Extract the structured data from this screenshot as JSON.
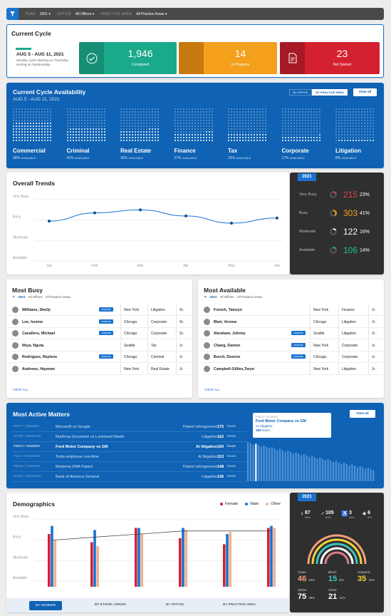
{
  "filter": {
    "year_label": "YEAR",
    "year": "2021",
    "office_label": "OFFICE",
    "office": "All Offices",
    "area_label": "PRACTICE AREA",
    "area": "All Practice Areas"
  },
  "current_cycle": {
    "title": "Current Cycle",
    "range": "AUG 5 - AUG 11, 2021",
    "note": "Weekly cycle starting on Thursday ending on Wednesday",
    "completed": {
      "value": "1,946",
      "label": "Completed",
      "color": "#1aa98a"
    },
    "in_progress": {
      "value": "14",
      "label": "In Progress",
      "color": "#f4a01c"
    },
    "not_started": {
      "value": "23",
      "label": "Not Started",
      "color": "#d4212f"
    }
  },
  "availability": {
    "title": "Current Cycle Availability",
    "range": "AUG 5 - AUG 11, 2021",
    "by_office": "BY OFFICE",
    "by_practice": "BY PRACTICE AREA",
    "view_all": "View all",
    "categories": [
      {
        "name": "Commercial",
        "pct": "58%",
        "suffix": "AVAILABLE",
        "fill": 0.58
      },
      {
        "name": "Criminal",
        "pct": "41%",
        "suffix": "AVAILABLE",
        "fill": 0.41
      },
      {
        "name": "Real Estate",
        "pct": "36%",
        "suffix": "AVAILABLE",
        "fill": 0.36
      },
      {
        "name": "Finance",
        "pct": "27%",
        "suffix": "AVAILABLE",
        "fill": 0.27
      },
      {
        "name": "Tax",
        "pct": "25%",
        "suffix": "AVAILABLE",
        "fill": 0.25
      },
      {
        "name": "Corporate",
        "pct": "17%",
        "suffix": "AVAILABLE",
        "fill": 0.17
      },
      {
        "name": "Litigation",
        "pct": "8%",
        "suffix": "AVAILABLE",
        "fill": 0.08
      }
    ]
  },
  "trends": {
    "title": "Overall Trends",
    "year": "2021",
    "stats": [
      {
        "label": "Very Busy",
        "value": "215",
        "pct": "23%",
        "color": "#e0424f",
        "fill": 0.23
      },
      {
        "label": "Busy",
        "value": "303",
        "pct": "41%",
        "color": "#f4a01c",
        "fill": 0.41
      },
      {
        "label": "Moderate",
        "value": "122",
        "pct": "16%",
        "color": "#ffffff",
        "fill": 0.16
      },
      {
        "label": "Available",
        "value": "106",
        "pct": "14%",
        "color": "#21c08a",
        "fill": 0.14
      }
    ]
  },
  "chart_data": [
    {
      "type": "line",
      "categories": [
        "Jan",
        "Feb",
        "Mar",
        "Apr",
        "May",
        "Jun"
      ],
      "y_categories": [
        "Available",
        "Moderate",
        "Busy",
        "Very Busy"
      ],
      "series": [
        {
          "values": [
            1.95,
            2.35,
            2.5,
            2.2,
            1.85,
            2.1
          ]
        }
      ],
      "grid": true
    },
    {
      "type": "bar",
      "categories": [
        "",
        "",
        "",
        "",
        "",
        ""
      ],
      "y_categories": [
        "Available",
        "Moderate",
        "Busy",
        "Very Busy"
      ],
      "series": [
        {
          "name": "Female",
          "color": "#d4212f",
          "values": [
            2.3,
            1.9,
            2.6,
            2.1,
            1.8,
            2.6
          ]
        },
        {
          "name": "Male",
          "color": "#1b73d1",
          "values": [
            2.7,
            2.5,
            2.6,
            2.6,
            2.3,
            2.7
          ]
        },
        {
          "name": "Other",
          "color": "#f2b08a",
          "values": [
            2.0,
            1.7,
            2.3,
            2.5,
            2.4,
            2.6
          ]
        }
      ],
      "line": [
        2.0,
        2.15,
        2.3,
        2.45,
        2.45,
        2.45
      ]
    }
  ],
  "most_busy": {
    "title": "Most Busy",
    "year": "2021",
    "office": "All Offices",
    "area": "All Practice Areas",
    "view_all": "VIEW ALL",
    "rows": [
      {
        "name": "Williams, Shelly",
        "badge": "DIVERSE",
        "city": "New York",
        "area": "Litigation",
        "level": "Sr."
      },
      {
        "name": "Lee, Ivonne",
        "badge": "DIVERSE",
        "city": "Chicago",
        "area": "Corporate",
        "level": "Sr."
      },
      {
        "name": "Cavallero, Michael",
        "badge": "DIVERSE",
        "city": "Chicago",
        "area": "Corporate",
        "level": "Sr."
      },
      {
        "name": "Ithya, Nguta",
        "badge": "",
        "city": "Seattle",
        "area": "Tax",
        "level": "Jr."
      },
      {
        "name": "Rodriguez, Raylene",
        "badge": "DIVERSE",
        "city": "Chicago",
        "area": "Criminal",
        "level": "Jr."
      },
      {
        "name": "Andrews, Hayman",
        "badge": "",
        "city": "New York",
        "area": "Real Estate",
        "level": "Jr."
      }
    ]
  },
  "most_available": {
    "title": "Most Available",
    "year": "2021",
    "office": "All Offices",
    "area": "All Practice Areas",
    "view_all": "VIEW ALL",
    "rows": [
      {
        "name": "French, Tamzyn",
        "badge": "",
        "city": "New York",
        "area": "Finance",
        "level": "Jr."
      },
      {
        "name": "Blair, Verona",
        "badge": "",
        "city": "Chicago",
        "area": "Litigation",
        "level": "Jr."
      },
      {
        "name": "Abraham, Johnny",
        "badge": "DIVERSE",
        "city": "Seattle",
        "area": "Litigation",
        "level": "Jr."
      },
      {
        "name": "Chang, Damon",
        "badge": "DIVERSE",
        "city": "New York",
        "area": "Corporate",
        "level": "Jr."
      },
      {
        "name": "Burch, Desiree",
        "badge": "DIVERSE",
        "city": "Chicago",
        "area": "Corporate",
        "level": "Jr."
      },
      {
        "name": "Campbell-Gillies,Taryn",
        "badge": "",
        "city": "New York",
        "area": "Litigation",
        "level": "Jr."
      }
    ]
  },
  "matters": {
    "title": "Most Active Matters",
    "view_all": "View all",
    "rows": [
      {
        "id": "MSFT / 4069483",
        "name": "Microsoft vs Google",
        "area": "Patent Infringement",
        "hours": "175",
        "unit": "hours",
        "active": false
      },
      {
        "id": "NTHP / 56584448",
        "name": "Northrup Grumman vs Lockheed Martin",
        "area": "Litigation",
        "hours": "162",
        "unit": "hours",
        "active": false
      },
      {
        "id": "FMCO / 9430003",
        "name": "Ford Motor Company vs GM",
        "area": "AI litigation",
        "hours": "160",
        "unit": "hours",
        "active": true
      },
      {
        "id": "TSLA / 56483659",
        "name": "Tesla employee overtime",
        "area": "AI litigation",
        "hours": "153",
        "unit": "hours",
        "active": false
      },
      {
        "id": "MDNA / 5494939",
        "name": "Moderna DNA Patent",
        "area": "Patent Infringement",
        "hours": "148",
        "unit": "hours",
        "active": false
      },
      {
        "id": "BAMS / 56584557",
        "name": "Bank of America General",
        "area": "Litigation",
        "hours": "136",
        "unit": "hours",
        "active": false
      }
    ],
    "tooltip": {
      "id": "FMCO / 9430003",
      "name": "Ford Motor Company vs GM",
      "area": "AI Litigation",
      "hours": "160",
      "unit": "hours"
    }
  },
  "demographics": {
    "title": "Demographics",
    "year": "2021",
    "legend": [
      "Female",
      "Male",
      "Other"
    ],
    "tabs": [
      "BY GENDER",
      "BY ETHNIC ORIGIN",
      "BY OFFICE",
      "BY PRACTICE AREA"
    ],
    "icon_stats": [
      {
        "value": "87",
        "pct": "49%"
      },
      {
        "value": "105",
        "pct": "61%"
      },
      {
        "value": "3",
        "pct": "34%"
      },
      {
        "value": "6",
        "pct": "8%"
      }
    ],
    "groups": [
      {
        "label": "Asian",
        "value": "46",
        "pct": "24%",
        "color": "#f2a07a"
      },
      {
        "label": "Black",
        "value": "15",
        "pct": "8%",
        "color": "#38c7c0"
      },
      {
        "label": "Hispanic",
        "value": "35",
        "pct": "16%",
        "color": "#f1d33a"
      },
      {
        "label": "White",
        "value": "75",
        "pct": "39%",
        "color": "#ffffff"
      },
      {
        "label": "Other",
        "value": "21",
        "pct": "11%",
        "color": "#ffffff"
      }
    ]
  }
}
